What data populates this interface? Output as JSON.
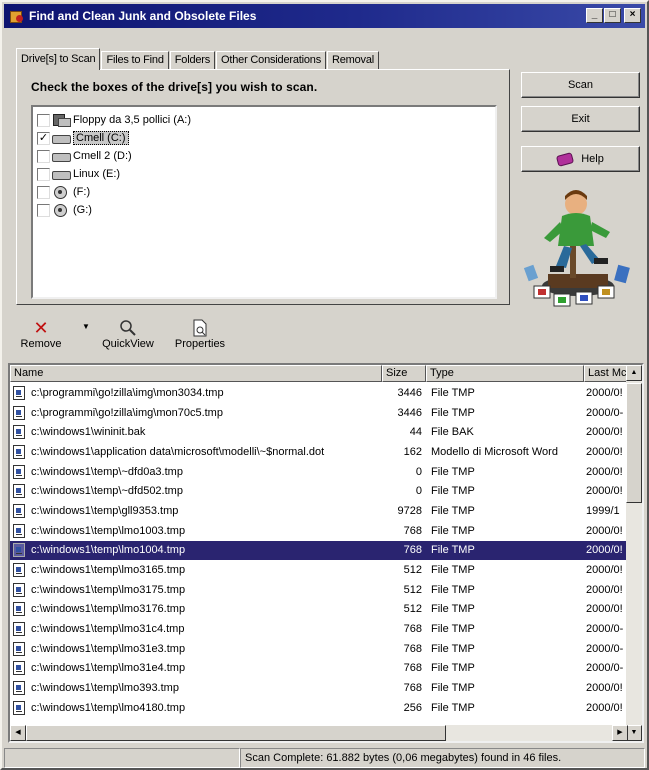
{
  "window": {
    "title": "Find and Clean Junk and Obsolete Files",
    "controls": [
      "_",
      "□",
      "×"
    ]
  },
  "tabs": [
    {
      "label": "Drive[s] to Scan",
      "active": true
    },
    {
      "label": "Files to Find",
      "active": false
    },
    {
      "label": "Folders",
      "active": false
    },
    {
      "label": "Other Considerations",
      "active": false
    },
    {
      "label": "Removal",
      "active": false
    }
  ],
  "panel": {
    "heading": "Check the boxes of the drive[s] you wish to scan."
  },
  "drives": [
    {
      "label": "Floppy da 3,5 pollici (A:)",
      "checked": false,
      "icon": "floppy-drive-icon"
    },
    {
      "label": "Cmell (C:)",
      "checked": true,
      "icon": "hard-drive-icon",
      "selected": true
    },
    {
      "label": "Cmell 2 (D:)",
      "checked": false,
      "icon": "hard-drive-icon"
    },
    {
      "label": "Linux (E:)",
      "checked": false,
      "icon": "hard-drive-icon"
    },
    {
      "label": "(F:)",
      "checked": false,
      "icon": "cd-drive-icon"
    },
    {
      "label": "(G:)",
      "checked": false,
      "icon": "cd-drive-icon"
    }
  ],
  "buttons": {
    "scan": "Scan",
    "exit": "Exit",
    "help": "Help"
  },
  "toolbar": {
    "remove": "Remove",
    "quickview": "QuickView",
    "properties": "Properties"
  },
  "list": {
    "columns": [
      "Name",
      "Size",
      "Type",
      "Last Mc"
    ],
    "rows": [
      {
        "name": "c:\\programmi\\go!zilla\\img\\mon3034.tmp",
        "size": "3446",
        "type": "File TMP",
        "date": "2000/0!"
      },
      {
        "name": "c:\\programmi\\go!zilla\\img\\mon70c5.tmp",
        "size": "3446",
        "type": "File TMP",
        "date": "2000/0-"
      },
      {
        "name": "c:\\windows1\\wininit.bak",
        "size": "44",
        "type": "File BAK",
        "date": "2000/0!"
      },
      {
        "name": "c:\\windows1\\application data\\microsoft\\modelli\\~$normal.dot",
        "size": "162",
        "type": "Modello di Microsoft Word",
        "date": "2000/0!"
      },
      {
        "name": "c:\\windows1\\temp\\~dfd0a3.tmp",
        "size": "0",
        "type": "File TMP",
        "date": "2000/0!"
      },
      {
        "name": "c:\\windows1\\temp\\~dfd502.tmp",
        "size": "0",
        "type": "File TMP",
        "date": "2000/0!"
      },
      {
        "name": "c:\\windows1\\temp\\gll9353.tmp",
        "size": "9728",
        "type": "File TMP",
        "date": "1999/1"
      },
      {
        "name": "c:\\windows1\\temp\\lmo1003.tmp",
        "size": "768",
        "type": "File TMP",
        "date": "2000/0!"
      },
      {
        "name": "c:\\windows1\\temp\\lmo1004.tmp",
        "size": "768",
        "type": "File TMP",
        "date": "2000/0!",
        "selected": true
      },
      {
        "name": "c:\\windows1\\temp\\lmo3165.tmp",
        "size": "512",
        "type": "File TMP",
        "date": "2000/0!"
      },
      {
        "name": "c:\\windows1\\temp\\lmo3175.tmp",
        "size": "512",
        "type": "File TMP",
        "date": "2000/0!"
      },
      {
        "name": "c:\\windows1\\temp\\lmo3176.tmp",
        "size": "512",
        "type": "File TMP",
        "date": "2000/0!"
      },
      {
        "name": "c:\\windows1\\temp\\lmo31c4.tmp",
        "size": "768",
        "type": "File TMP",
        "date": "2000/0-"
      },
      {
        "name": "c:\\windows1\\temp\\lmo31e3.tmp",
        "size": "768",
        "type": "File TMP",
        "date": "2000/0-"
      },
      {
        "name": "c:\\windows1\\temp\\lmo31e4.tmp",
        "size": "768",
        "type": "File TMP",
        "date": "2000/0-"
      },
      {
        "name": "c:\\windows1\\temp\\lmo393.tmp",
        "size": "768",
        "type": "File TMP",
        "date": "2000/0!"
      },
      {
        "name": "c:\\windows1\\temp\\lmo4180.tmp",
        "size": "256",
        "type": "File TMP",
        "date": "2000/0!"
      }
    ]
  },
  "status": {
    "text": "Scan Complete: 61.882 bytes (0,06 megabytes) found in 46 files."
  },
  "colors": {
    "title_bar": "#0e1470",
    "selection": "#2a2470",
    "face": "#d6d3cc",
    "remove_icon": "#c01010"
  }
}
